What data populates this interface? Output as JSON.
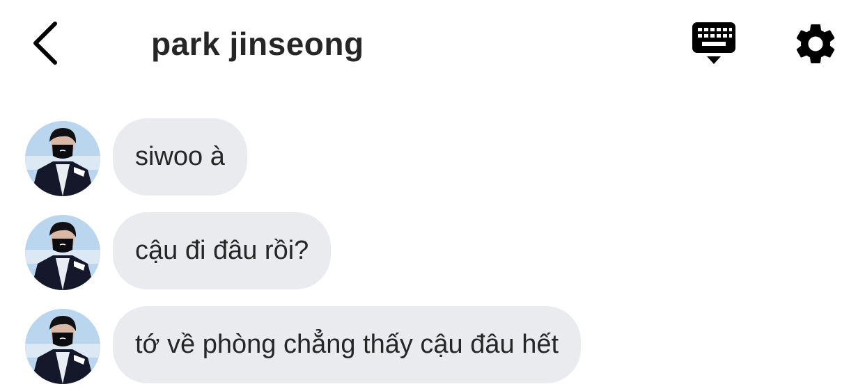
{
  "header": {
    "back_icon": "chevron-left-icon",
    "title": "park jinseong",
    "keyboard_icon": "keyboard-icon",
    "settings_icon": "gear-icon"
  },
  "messages": [
    {
      "text": "siwoo à"
    },
    {
      "text": "cậu đi đâu rồi?"
    },
    {
      "text": "tớ về phòng chẳng thấy cậu đâu hết"
    }
  ],
  "colors": {
    "bubble_background": "#e9ebef",
    "text": "#262626",
    "icon": "#000000"
  }
}
